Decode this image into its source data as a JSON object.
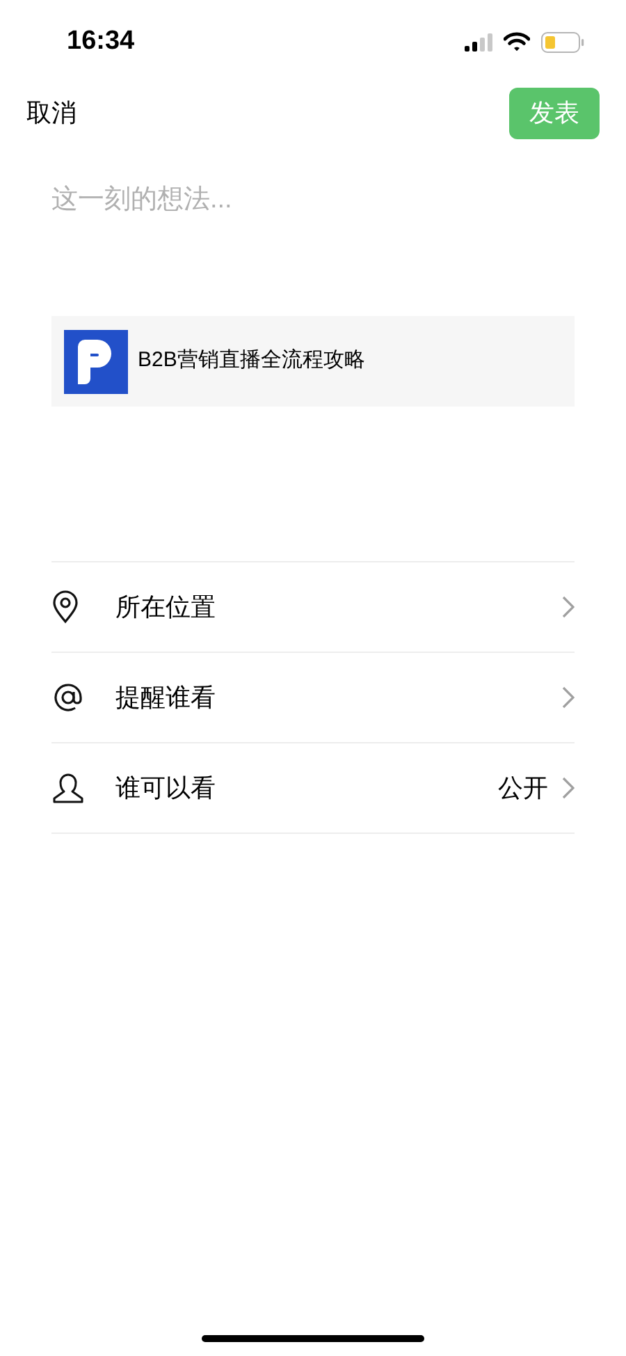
{
  "status_bar": {
    "time": "16:34"
  },
  "nav": {
    "cancel": "取消",
    "publish": "发表"
  },
  "composer": {
    "placeholder": "这一刻的想法..."
  },
  "link_card": {
    "title": "B2B营销直播全流程攻略"
  },
  "options": [
    {
      "kind": "location",
      "label": "所在位置"
    },
    {
      "kind": "mention",
      "label": "提醒谁看"
    },
    {
      "kind": "audience",
      "label": "谁可以看",
      "value": "公开"
    }
  ]
}
